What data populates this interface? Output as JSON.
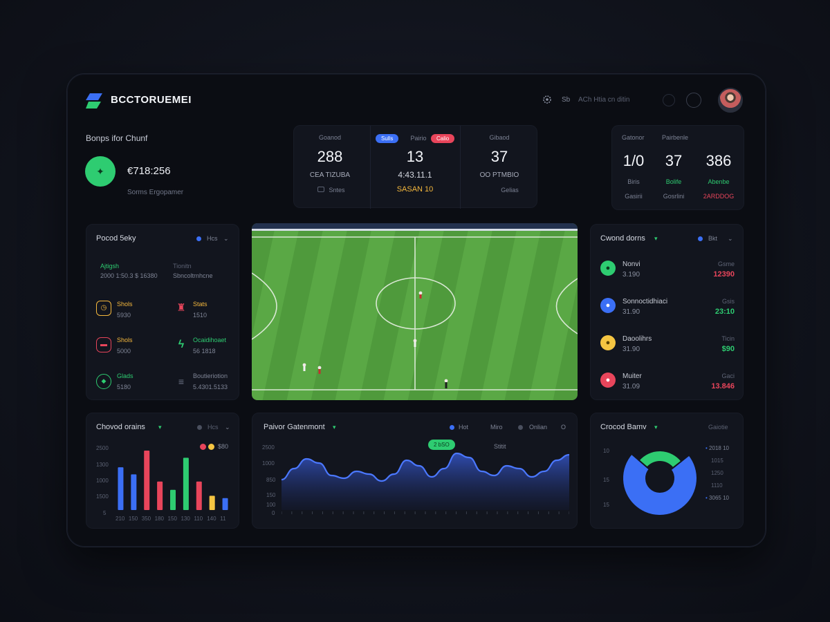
{
  "header": {
    "logo_text": "BCCTORUEMEI",
    "search_label": "Sb",
    "search_text": "ACh Htia cn ditin"
  },
  "summary": {
    "title": "Bonps ifor Chunf",
    "value": "€718:256",
    "subtitle": "Sorms Ergopamer"
  },
  "match_stats": {
    "pill_left": "Sulls",
    "pill_right": "Calio",
    "columns": [
      {
        "label": "Goanod",
        "value": "288",
        "sub": "CEA TIZUBA",
        "foot": "Sntes"
      },
      {
        "label": "Pairio",
        "value": "13",
        "sub": "4:43.11.1",
        "foot": "SASAN 10"
      },
      {
        "label": "Gibaod",
        "value": "37",
        "sub": "OO PTMBIO",
        "foot": "Gelias"
      }
    ]
  },
  "right_stats": {
    "labels": [
      "Gatonor",
      "Pairbenle"
    ],
    "columns": [
      {
        "value": "1/0",
        "sub": "Biris",
        "foot": "Gasirii"
      },
      {
        "value": "37",
        "sub": "Bolife",
        "foot": "Gosrlini"
      },
      {
        "value": "386",
        "sub": "Abenbe",
        "foot": "2ARDDOG"
      }
    ]
  },
  "player_stats": {
    "title": "Pocod 5eky",
    "legend": "Hcs",
    "legend_color": "#3b6ff5",
    "top_left_label": "Ajtigsh",
    "top_left_value": "2000 1:50.3 $ 16380",
    "top_right_label": "Tionitn",
    "top_right_value": "Sbncoltrnhcne",
    "items": [
      {
        "icon": "timer-icon",
        "label": "Shols",
        "value": "5930",
        "color": "#f5b83d"
      },
      {
        "icon": "trophy-icon",
        "label": "Stats",
        "value": "1510",
        "color": "#e8455b"
      },
      {
        "icon": "shirt-icon",
        "label": "Shols",
        "value": "5000",
        "color": "#e8455b"
      },
      {
        "icon": "bolt-icon",
        "label": "Ocaidihoaet",
        "value": "56 1818",
        "color": "#2ecc71"
      },
      {
        "icon": "shield-icon",
        "label": "Glads",
        "value": "5180",
        "color": "#2ecc71"
      },
      {
        "icon": "list-icon",
        "label": "Boutieriotion",
        "value": "5.4301.5133",
        "color": "#6b7184"
      }
    ]
  },
  "crowd_list": {
    "title": "Cwond dorns",
    "legend": "Bkt",
    "legend_color": "#3b6ff5",
    "rows": [
      {
        "name": "Nonvi",
        "num": "3.190",
        "right_label": "Gsme",
        "right_value": "12390",
        "color": "#2ecc71",
        "value_color": "#e8455b"
      },
      {
        "name": "Sonnoctidhiaci",
        "num": "31.90",
        "right_label": "Gsis",
        "right_value": "23:10",
        "color": "#3b6ff5",
        "value_color": "#2ecc71"
      },
      {
        "name": "Daoolihrs",
        "num": "31.90",
        "right_label": "Ticin",
        "right_value": "$90",
        "color": "#f5c542",
        "value_color": "#2ecc71"
      },
      {
        "name": "Muiter",
        "num": "31.09",
        "right_label": "Gaci",
        "right_value": "13.846",
        "color": "#e8455b",
        "value_color": "#e8455b"
      }
    ]
  },
  "bar_card": {
    "title": "Chovod orains",
    "legend_value": "$80",
    "legend_dot_1": "#e8455b",
    "legend_dot_2": "#f5c542",
    "y_labels": [
      "2500",
      "1300",
      "1000",
      "1500",
      "5"
    ],
    "x_labels": [
      "210",
      "150",
      "350",
      "180",
      "150",
      "130",
      "110",
      "140",
      "11"
    ]
  },
  "line_card": {
    "title": "Paivor Gatenmont",
    "legend_1": "Hot",
    "legend_2": "Miro",
    "legend_3": "Onlian",
    "legend_4": "O",
    "tooltip_1": "2 bSO",
    "tooltip_2": "Stitit",
    "y_labels": [
      "2500",
      "1000",
      "850",
      "150",
      "100",
      "0"
    ]
  },
  "donut_card": {
    "title": "Crocod Bamv",
    "legend_top": "Gaiotie",
    "y_labels": [
      "10",
      "15",
      "15"
    ],
    "right_labels": [
      "2018 10",
      "1015",
      "1250",
      "1110",
      "3065 10"
    ]
  },
  "chart_data": [
    {
      "type": "bar",
      "title": "Chovod orains",
      "ylim": [
        0,
        2500
      ],
      "series": [
        {
          "name": "",
          "color": "#3b6ff5",
          "values": [
            1800,
            1500,
            0,
            0,
            0,
            0,
            0,
            0,
            500
          ]
        },
        {
          "name": "",
          "color": "#2ecc71",
          "values": [
            0,
            0,
            0,
            0,
            850,
            2200,
            0,
            0,
            0
          ]
        },
        {
          "name": "",
          "color": "#e8455b",
          "values": [
            0,
            0,
            2500,
            1200,
            0,
            0,
            1200,
            0,
            0
          ]
        },
        {
          "name": "",
          "color": "#f5c542",
          "values": [
            0,
            0,
            0,
            0,
            0,
            0,
            0,
            600,
            0
          ]
        }
      ]
    },
    {
      "type": "area",
      "title": "Paivor Gatenmont",
      "ylim": [
        0,
        2500
      ],
      "values": [
        1100,
        1500,
        1850,
        1700,
        1250,
        1150,
        1400,
        1300,
        1050,
        1300,
        1800,
        1600,
        1200,
        1500,
        2050,
        1900,
        1400,
        1250,
        1600,
        1500,
        1200,
        1400,
        1800,
        2000
      ]
    },
    {
      "type": "pie",
      "title": "Crocod Bamv",
      "slices": [
        {
          "label": "",
          "value": 72,
          "color": "#3b6ff5"
        },
        {
          "label": "",
          "value": 28,
          "color": "#2ecc71"
        }
      ]
    }
  ]
}
